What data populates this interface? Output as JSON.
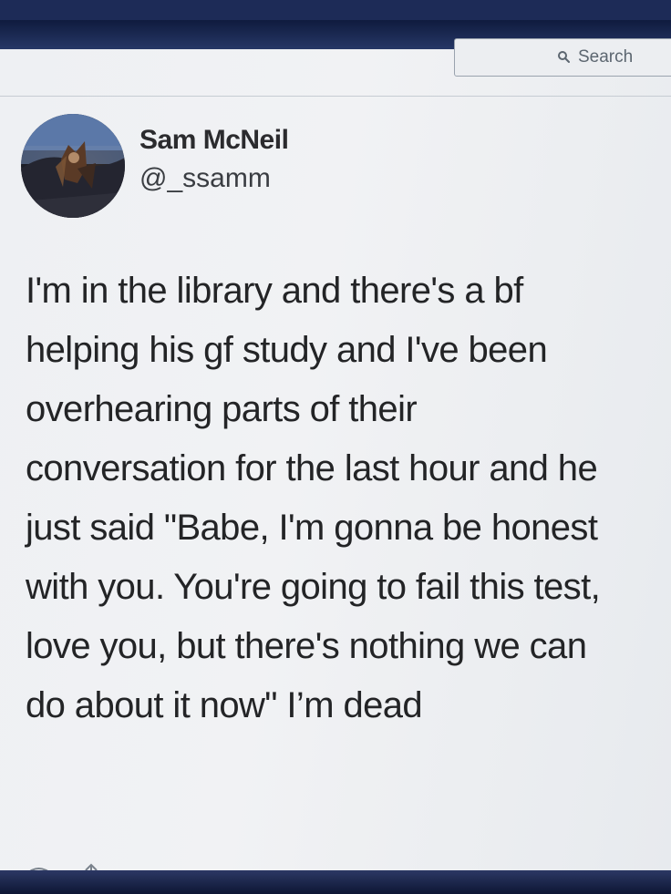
{
  "search": {
    "placeholder": "Search",
    "icon": "magnifier"
  },
  "tweet": {
    "display_name": "Sam McNeil",
    "handle": "@_ssamm",
    "avatar": "profile-photo",
    "lines": [
      "I'm in the library and there's a bf",
      "helping his gf study and I've been",
      "overhearing parts of their",
      "conversation for the last hour and he",
      "just said \"Babe, I'm gonna be honest",
      "with you. You're going to fail this test,",
      "love you, but there's nothing we can",
      "do about it now\" I’m dead"
    ]
  },
  "footer": {
    "icons": [
      "reply-icon",
      "retweet-icon"
    ]
  }
}
